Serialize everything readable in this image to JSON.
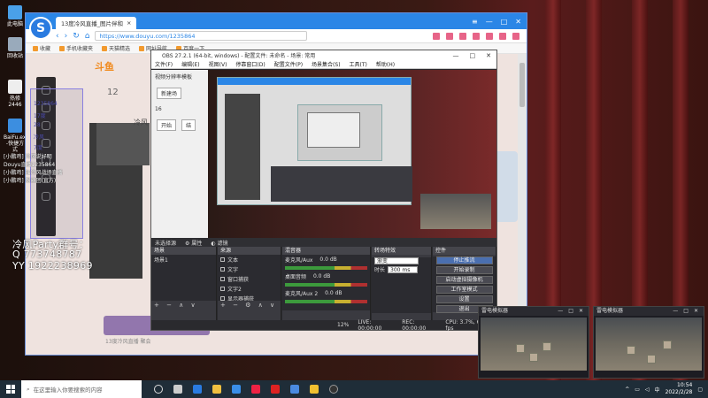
{
  "desktop": {
    "icons": [
      {
        "label": "此电脑"
      },
      {
        "label": "回收站"
      },
      {
        "label": "热修\n2446"
      },
      {
        "label": "BaiFu.exe\n-快捷方式"
      }
    ]
  },
  "browser": {
    "tab_title": "13度冷风直播_图片伴和",
    "url": "https://www.douyu.com/1235864",
    "bookmarks": [
      "收藏",
      "手机收藏夹",
      "天猫精选",
      "网址导航",
      "百度一下"
    ]
  },
  "douyu_page": {
    "logo": "斗鱼",
    "number": "12",
    "streamer_name": "冷风",
    "footer": "13度冷风直播 聚会"
  },
  "overlay": {
    "lines": [
      "1235864",
      "17度",
      "28",
      "冷风",
      "7度"
    ],
    "chat": [
      "[小鹏鸡] 冷风说好明",
      "Douyu直播1235864",
      "[小鹏鸡] 加冷风战场直播",
      "[小鹏鸡] 粉丝团(官方)"
    ],
    "party_line": "冷风Party群号：",
    "qq_line": "Q 773748787",
    "yy_line": "YY 1922238969"
  },
  "obs": {
    "title": "OBS 27.2.1 (64-bit, windows) - 配置文件: 未命名 - 场景: 常用",
    "menu": [
      "文件(F)",
      "编辑(E)",
      "视图(V)",
      "停靠窗口(D)",
      "配置文件(P)",
      "场景集合(S)",
      "工具(T)",
      "帮助(H)"
    ],
    "left_panel": {
      "title": "视频分辨率模板",
      "new_btn": "新建场",
      "row1": "16",
      "start_btn": "开始",
      "end_btn": "结"
    },
    "bar": {
      "no_source": "未选择源",
      "props": "属性",
      "filters": "滤镜"
    },
    "scenes": {
      "header": "场景",
      "items": [
        "场景1"
      ],
      "foot": "+ − ∧ ∨"
    },
    "sources": {
      "header": "来源",
      "items": [
        "文本",
        "文字",
        "窗口捕获",
        "文字2",
        "显示器捕获"
      ],
      "foot": "+ − ⚙ ∧ ∨"
    },
    "mixer": {
      "header": "混音器",
      "tracks": [
        "麦克风/Aux",
        "桌面音频",
        "麦克风/Aux 2"
      ],
      "db": [
        "0.0 dB",
        "0.0 dB",
        "0.0 dB"
      ]
    },
    "transitions": {
      "header": "转场特效",
      "type": "渐变",
      "duration_label": "时长",
      "duration": "300 ms"
    },
    "controls": {
      "header": "控件",
      "buttons": [
        "停止推流",
        "开始录制",
        "启动虚拟摄像机",
        "工作室模式",
        "设置",
        "退出"
      ]
    },
    "status": {
      "live_label": "LIVE:",
      "live_time": "00:00:00",
      "rec_label": "REC:",
      "rec_time": "00:00:00",
      "cpu": "CPU: 3.7%, 60.00 fps",
      "dropped": "12%"
    }
  },
  "thumbs": [
    {
      "title": "雷电模拟器"
    },
    {
      "title": "雷电模拟器"
    }
  ],
  "taskbar": {
    "search_placeholder": "在这里输入你要搜索的内容",
    "time": "10:54",
    "date": "2022/2/28",
    "lang": "中"
  }
}
